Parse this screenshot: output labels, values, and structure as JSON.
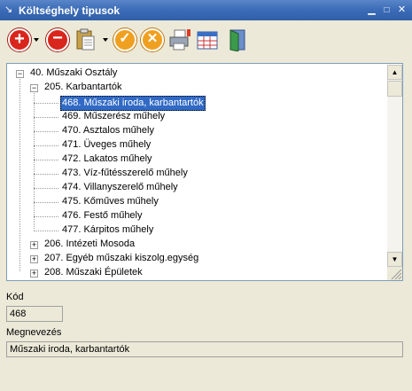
{
  "window": {
    "title": "Költséghely tipusok"
  },
  "toolbar": {
    "icons": [
      "add-icon",
      "remove-icon",
      "paste-icon",
      "confirm-icon",
      "cancel-icon",
      "print-icon",
      "table-icon",
      "exit-icon"
    ]
  },
  "tree": {
    "root": {
      "label": "40. Műszaki Osztály"
    },
    "group205": {
      "label": "205. Karbantartók"
    },
    "leaves": [
      {
        "label": "468. Műszaki iroda, karbantartók"
      },
      {
        "label": "469. Műszerész műhely"
      },
      {
        "label": "470. Asztalos műhely"
      },
      {
        "label": "471. Üveges műhely"
      },
      {
        "label": "472. Lakatos műhely"
      },
      {
        "label": "473. Víz-fűtésszerelő műhely"
      },
      {
        "label": "474. Villanyszerelő műhely"
      },
      {
        "label": "475. Kőműves műhely"
      },
      {
        "label": "476. Festő műhely"
      },
      {
        "label": "477. Kárpitos műhely"
      }
    ],
    "collapsed": [
      {
        "label": "206. Intézeti Mosoda"
      },
      {
        "label": "207. Egyéb műszaki kiszolg.egység"
      },
      {
        "label": "208. Műszaki Épületek"
      }
    ]
  },
  "form": {
    "kod_label": "Kód",
    "kod_value": "468",
    "megnevezes_label": "Megnevezés",
    "megnevezes_value": "Műszaki iroda, karbantartók"
  },
  "colors": {
    "titlebar": "#3d6db8",
    "selection": "#316ac5"
  }
}
